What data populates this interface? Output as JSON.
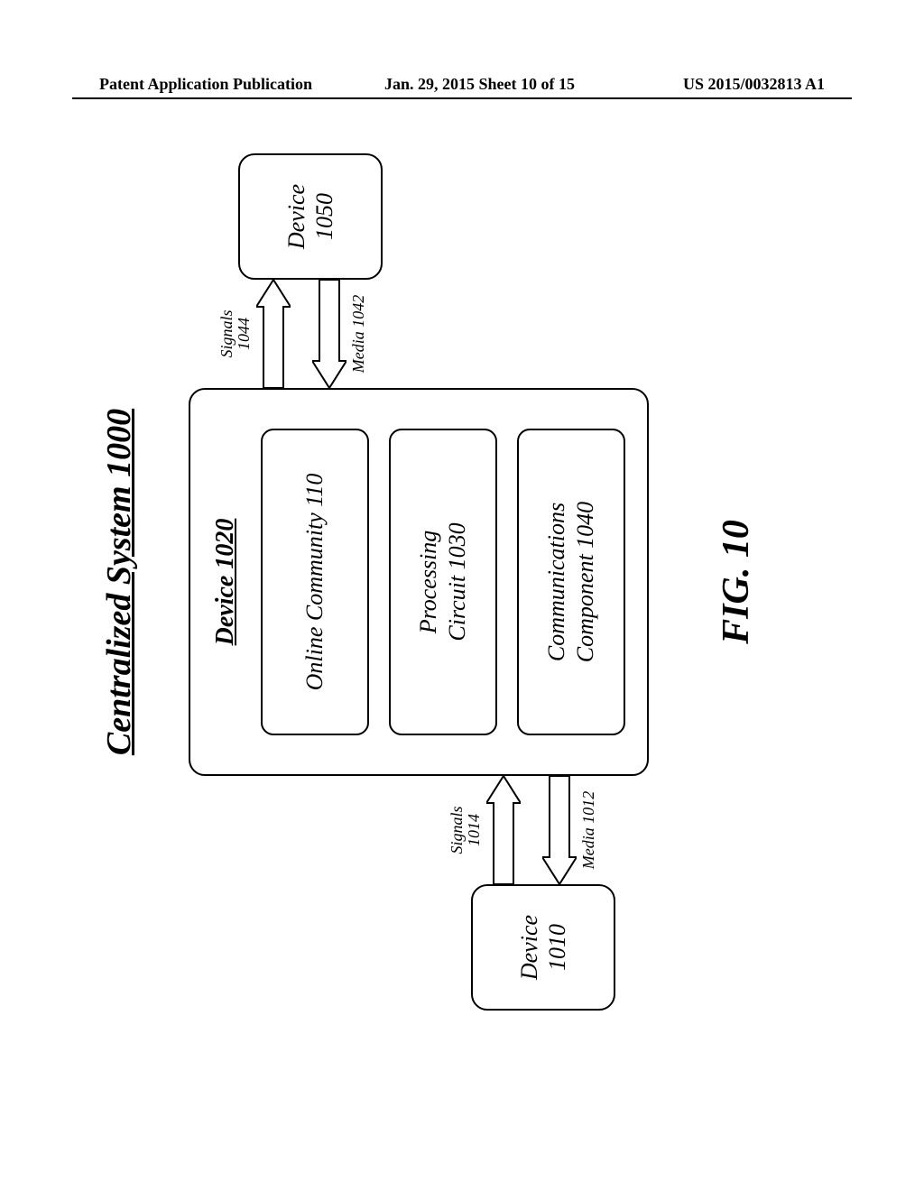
{
  "header": {
    "left": "Patent Application Publication",
    "center": "Jan. 29, 2015  Sheet 10 of 15",
    "right": "US 2015/0032813 A1"
  },
  "figure": {
    "system_title": "Centralized System 1000",
    "caption": "FIG. 10",
    "device_1010": {
      "label": "Device",
      "num": "1010"
    },
    "device_1020": {
      "title": "Device 1020",
      "online_community": "Online Community 110",
      "processing": {
        "l1": "Processing",
        "l2": "Circuit 1030"
      },
      "communications": {
        "l1": "Communications",
        "l2": "Component 1040"
      }
    },
    "device_1050": {
      "label": "Device",
      "num": "1050"
    },
    "arrows": {
      "left": {
        "signals": {
          "l1": "Signals",
          "l2": "1014"
        },
        "media": "Media 1012"
      },
      "right": {
        "signals": {
          "l1": "Signals",
          "l2": "1044"
        },
        "media": "Media 1042"
      }
    }
  }
}
